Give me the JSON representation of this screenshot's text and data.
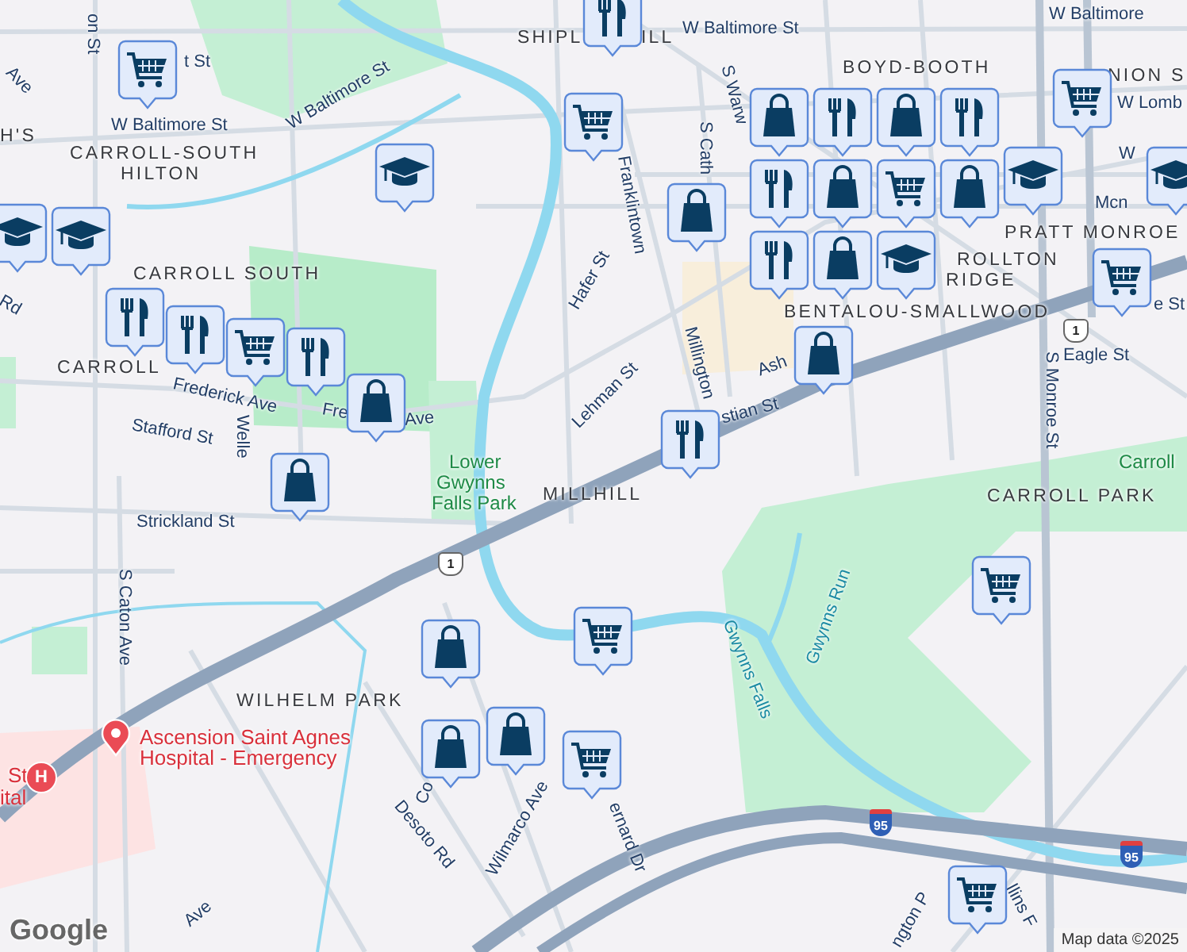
{
  "map": {
    "labels": [
      {
        "text": "on St",
        "kind": "street"
      },
      {
        "text": "t St",
        "kind": "street"
      },
      {
        "text": "W Baltimore St",
        "kind": "street"
      },
      {
        "text": "W Baltimore St",
        "kind": "street"
      },
      {
        "text": "SHIPL",
        "kind": "area"
      },
      {
        "text": "ILL",
        "kind": "area"
      },
      {
        "text": "W Baltimore St",
        "kind": "street"
      },
      {
        "text": "W Baltimore",
        "kind": "street"
      },
      {
        "text": "BOYD-BOOTH",
        "kind": "area"
      },
      {
        "text": "NION S",
        "kind": "area"
      },
      {
        "text": "W Lomb",
        "kind": "street"
      },
      {
        "text": "W",
        "kind": "street"
      },
      {
        "text": "H'S",
        "kind": "area"
      },
      {
        "text": "Ave",
        "kind": "street"
      },
      {
        "text": "CARROLL-SOUTH",
        "kind": "area"
      },
      {
        "text": "HILTON",
        "kind": "area"
      },
      {
        "text": "CARROLL SOUTH",
        "kind": "area"
      },
      {
        "text": "CARROLL",
        "kind": "area"
      },
      {
        "text": "Rd",
        "kind": "street"
      },
      {
        "text": "Frederick Ave",
        "kind": "street"
      },
      {
        "text": "Fre",
        "kind": "street"
      },
      {
        "text": "Ave",
        "kind": "street"
      },
      {
        "text": "Stafford St",
        "kind": "street"
      },
      {
        "text": "Welle",
        "kind": "street"
      },
      {
        "text": "Lower",
        "kind": "park"
      },
      {
        "text": "Gwynns",
        "kind": "park"
      },
      {
        "text": "Falls Park",
        "kind": "park"
      },
      {
        "text": "Strickland St",
        "kind": "street"
      },
      {
        "text": "S Caton Ave",
        "kind": "street"
      },
      {
        "text": "MILLHILL",
        "kind": "area"
      },
      {
        "text": "Hafer St",
        "kind": "street"
      },
      {
        "text": "Franklintown",
        "kind": "street"
      },
      {
        "text": "S Cath",
        "kind": "street"
      },
      {
        "text": "S Warw",
        "kind": "street"
      },
      {
        "text": "Millington",
        "kind": "street"
      },
      {
        "text": "Lehman St",
        "kind": "street"
      },
      {
        "text": "Ash",
        "kind": "street"
      },
      {
        "text": "stian St",
        "kind": "street"
      },
      {
        "text": "ROLLTON",
        "kind": "area"
      },
      {
        "text": "RIDGE",
        "kind": "area"
      },
      {
        "text": "PRATT MONROE",
        "kind": "area"
      },
      {
        "text": "Mcn",
        "kind": "street"
      },
      {
        "text": "BENTALOU-SMALLWOOD",
        "kind": "area"
      },
      {
        "text": "S Monroe St",
        "kind": "street"
      },
      {
        "text": "Eagle St",
        "kind": "street"
      },
      {
        "text": "e St",
        "kind": "street"
      },
      {
        "text": "Carroll",
        "kind": "park"
      },
      {
        "text": "CARROLL PARK",
        "kind": "area"
      },
      {
        "text": "Gwynns Run",
        "kind": "water"
      },
      {
        "text": "Gwynns Falls",
        "kind": "water"
      },
      {
        "text": "WILHELM PARK",
        "kind": "area"
      },
      {
        "text": "Ascension Saint Agnes",
        "kind": "poi"
      },
      {
        "text": "Hospital - Emergency",
        "kind": "poi"
      },
      {
        "text": "St",
        "kind": "poi"
      },
      {
        "text": "ital",
        "kind": "poi"
      },
      {
        "text": "Co",
        "kind": "street"
      },
      {
        "text": "Desoto Rd",
        "kind": "street"
      },
      {
        "text": "Wilmarco Ave",
        "kind": "street"
      },
      {
        "text": "ernard Dr",
        "kind": "street"
      },
      {
        "text": "Ave",
        "kind": "street"
      },
      {
        "text": "ngton P",
        "kind": "street"
      },
      {
        "text": "llins F",
        "kind": "street"
      }
    ],
    "shields": [
      {
        "kind": "us",
        "number": "1"
      },
      {
        "kind": "us",
        "number": "1"
      },
      {
        "kind": "interstate",
        "number": "95"
      },
      {
        "kind": "interstate",
        "number": "95"
      }
    ],
    "poi_markers": [
      {
        "kind": "pin"
      },
      {
        "kind": "hospital",
        "glyph": "H"
      }
    ],
    "pins": [
      {
        "kind": "cart"
      },
      {
        "kind": "school"
      },
      {
        "kind": "school"
      },
      {
        "kind": "school"
      },
      {
        "kind": "food"
      },
      {
        "kind": "food"
      },
      {
        "kind": "cart"
      },
      {
        "kind": "food"
      },
      {
        "kind": "bag"
      },
      {
        "kind": "bag"
      },
      {
        "kind": "food"
      },
      {
        "kind": "cart"
      },
      {
        "kind": "bag"
      },
      {
        "kind": "food"
      },
      {
        "kind": "bag"
      },
      {
        "kind": "food"
      },
      {
        "kind": "bag"
      },
      {
        "kind": "cart"
      },
      {
        "kind": "food"
      },
      {
        "kind": "bag"
      },
      {
        "kind": "school"
      },
      {
        "kind": "bag"
      },
      {
        "kind": "food"
      },
      {
        "kind": "bag"
      },
      {
        "kind": "school"
      },
      {
        "kind": "bag"
      },
      {
        "kind": "food"
      },
      {
        "kind": "cart"
      },
      {
        "kind": "school"
      },
      {
        "kind": "cart"
      },
      {
        "kind": "cart"
      },
      {
        "kind": "bag"
      },
      {
        "kind": "cart"
      },
      {
        "kind": "bag"
      },
      {
        "kind": "bag"
      },
      {
        "kind": "cart"
      },
      {
        "kind": "cart"
      }
    ],
    "logo": "Google",
    "attribution": "Map data ©2025"
  }
}
